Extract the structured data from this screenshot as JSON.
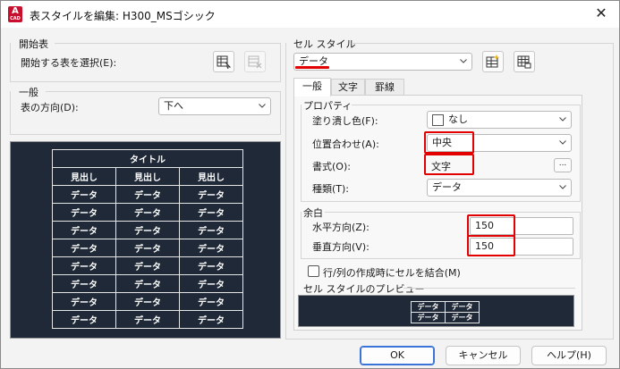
{
  "window": {
    "title": "表スタイルを編集: H300_MSゴシック",
    "close": "✕"
  },
  "app_icon": {
    "letter": "A",
    "sub": "CAD"
  },
  "start_table": {
    "group_label": "開始表",
    "select_label": "開始する表を選択(E):"
  },
  "general_left": {
    "group_label": "一般",
    "direction_label": "表の方向(D):",
    "direction_value": "下へ"
  },
  "preview_table": {
    "title": "タイトル",
    "headers": [
      "見出し",
      "見出し",
      "見出し"
    ],
    "rows": [
      [
        "データ",
        "データ",
        "データ"
      ],
      [
        "データ",
        "データ",
        "データ"
      ],
      [
        "データ",
        "データ",
        "データ"
      ],
      [
        "データ",
        "データ",
        "データ"
      ],
      [
        "データ",
        "データ",
        "データ"
      ],
      [
        "データ",
        "データ",
        "データ"
      ],
      [
        "データ",
        "データ",
        "データ"
      ],
      [
        "データ",
        "データ",
        "データ"
      ]
    ]
  },
  "cell_style": {
    "group_label": "セル スタイル",
    "selected": "データ"
  },
  "tabs": [
    {
      "label": "一般"
    },
    {
      "label": "文字"
    },
    {
      "label": "罫線"
    }
  ],
  "properties": {
    "group_label": "プロパティ",
    "fill_label": "塗り潰し色(F):",
    "fill_value": "なし",
    "align_label": "位置合わせ(A):",
    "align_value": "中央",
    "format_label": "書式(O):",
    "format_value": "文字",
    "format_button": "...",
    "type_label": "種類(T):",
    "type_value": "データ"
  },
  "margins": {
    "group_label": "余白",
    "horizontal_label": "水平方向(Z):",
    "horizontal_value": "150",
    "vertical_label": "垂直方向(V):",
    "vertical_value": "150"
  },
  "merge_checkbox": {
    "label": "行/列の作成時にセルを結合(M)"
  },
  "cell_preview": {
    "group_label": "セル スタイルのプレビュー",
    "cells": [
      [
        "データ",
        "データ"
      ],
      [
        "データ",
        "データ"
      ]
    ]
  },
  "buttons": {
    "ok": "OK",
    "cancel": "キャンセル",
    "help": "ヘルプ(H)"
  },
  "colors": {
    "highlight": "#e30000",
    "preview_bg": "#1f2937",
    "primary_border": "#3a74d8"
  }
}
